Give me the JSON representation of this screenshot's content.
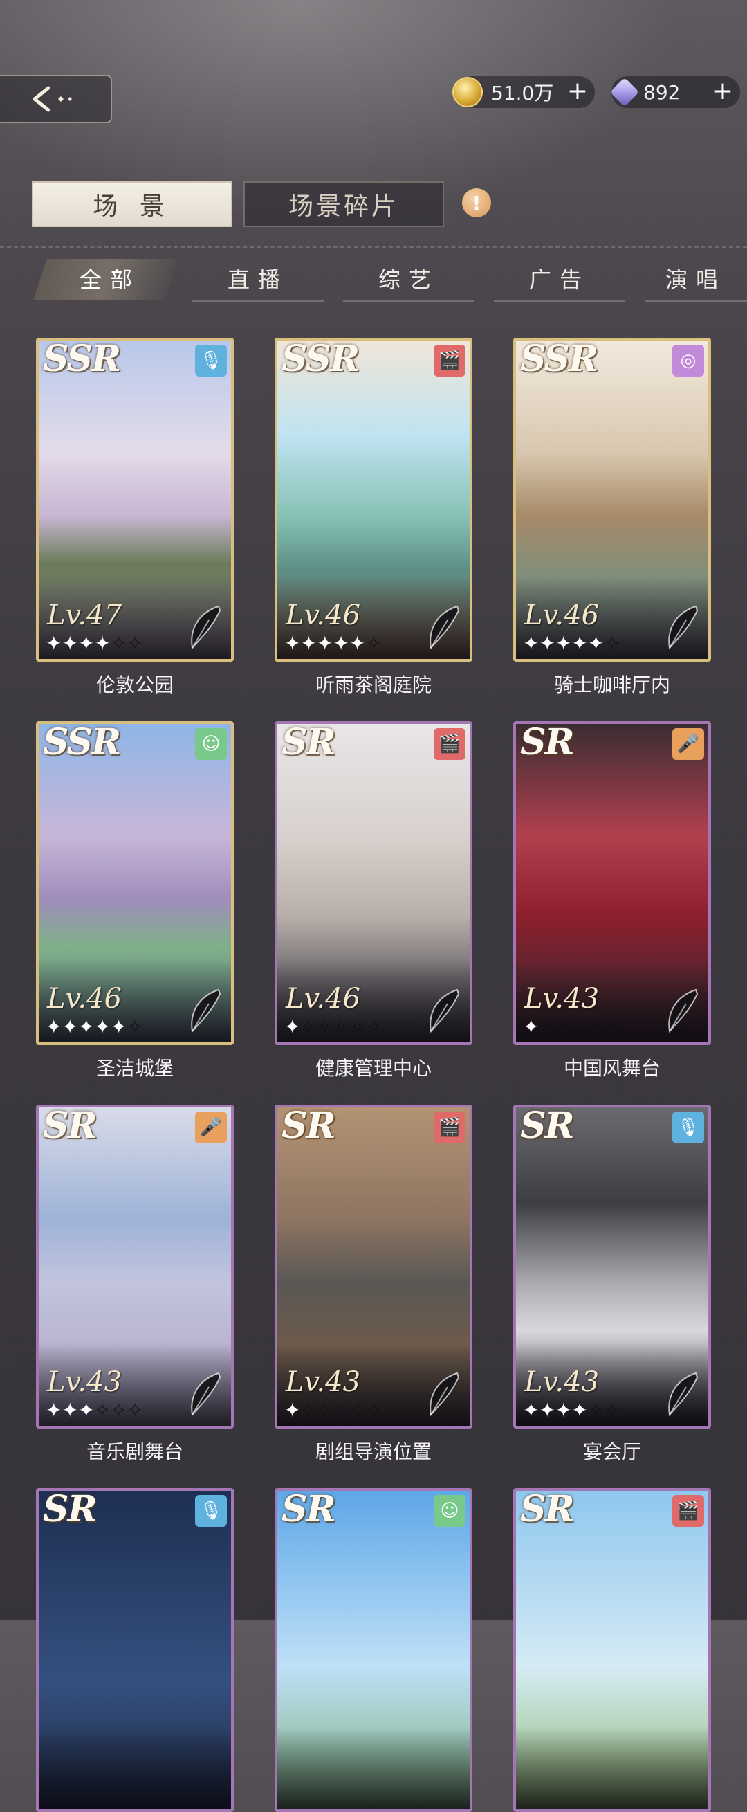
{
  "header": {
    "back_icon": "back-arrow-icon",
    "coins": {
      "value": "51.0万",
      "plus": "+",
      "icon": "gold-coin-icon"
    },
    "gems": {
      "value": "892",
      "plus": "+",
      "icon": "diamond-icon"
    }
  },
  "main_tabs": [
    {
      "label": "场 景",
      "active": true
    },
    {
      "label": "场景碎片",
      "active": false
    }
  ],
  "alert_mark": "!",
  "categories": [
    {
      "label": "全部",
      "active": true
    },
    {
      "label": "直播",
      "active": false
    },
    {
      "label": "综艺",
      "active": false
    },
    {
      "label": "广告",
      "active": false
    },
    {
      "label": "演唱",
      "active": false
    }
  ],
  "cards": [
    {
      "rarity": "SSR",
      "level": "Lv.47",
      "stars": 4,
      "name": "伦敦公园",
      "badge": "microphone-icon",
      "badge_glyph": "🎙"
    },
    {
      "rarity": "SSR",
      "level": "Lv.46",
      "stars": 5,
      "name": "听雨茶阁庭院",
      "badge": "film-clapper-icon",
      "badge_glyph": "🎬"
    },
    {
      "rarity": "SSR",
      "level": "Lv.46",
      "stars": 5,
      "name": "骑士咖啡厅内",
      "badge": "ring-icon",
      "badge_glyph": "◎"
    },
    {
      "rarity": "SSR",
      "level": "Lv.46",
      "stars": 5,
      "name": "圣洁城堡",
      "badge": "smile-icon",
      "badge_glyph": "☺"
    },
    {
      "rarity": "SR",
      "level": "Lv.46",
      "stars": 1,
      "name": "健康管理中心",
      "badge": "film-clapper-icon",
      "badge_glyph": "🎬"
    },
    {
      "rarity": "SR",
      "level": "Lv.43",
      "stars": 1,
      "name": "中国风舞台",
      "badge": "handheld-mic-icon",
      "badge_glyph": "🎤"
    },
    {
      "rarity": "SR",
      "level": "Lv.43",
      "stars": 3,
      "name": "音乐剧舞台",
      "badge": "handheld-mic-icon",
      "badge_glyph": "🎤"
    },
    {
      "rarity": "SR",
      "level": "Lv.43",
      "stars": 1,
      "name": "剧组导演位置",
      "badge": "film-clapper-icon",
      "badge_glyph": "🎬"
    },
    {
      "rarity": "SR",
      "level": "Lv.43",
      "stars": 4,
      "name": "宴会厅",
      "badge": "microphone-icon",
      "badge_glyph": "🎙"
    },
    {
      "rarity": "SR",
      "level": "",
      "stars": 0,
      "name": "",
      "badge": "microphone-icon",
      "badge_glyph": "🎙"
    },
    {
      "rarity": "SR",
      "level": "",
      "stars": 0,
      "name": "",
      "badge": "smile-icon",
      "badge_glyph": "☺"
    },
    {
      "rarity": "SR",
      "level": "",
      "stars": 0,
      "name": "",
      "badge": "film-clapper-icon",
      "badge_glyph": "🎬"
    }
  ]
}
